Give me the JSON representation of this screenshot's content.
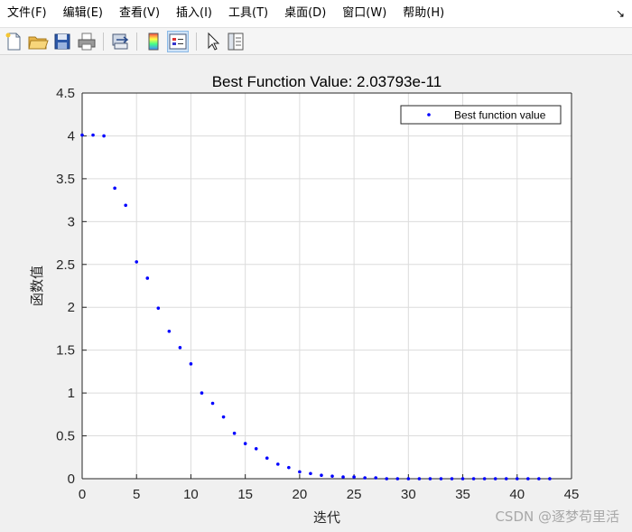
{
  "menu": {
    "items": [
      "文件(F)",
      "编辑(E)",
      "查看(V)",
      "插入(I)",
      "工具(T)",
      "桌面(D)",
      "窗口(W)",
      "帮助(H)"
    ],
    "overflow_glyph": "↘"
  },
  "toolbar": {
    "icons": [
      "new-figure-icon",
      "open-file-icon",
      "save-icon",
      "print-icon",
      "link-plot-icon",
      "colorbar-icon",
      "legend-icon",
      "pointer-icon",
      "property-inspector-icon"
    ]
  },
  "watermark": "CSDN @逐梦苟里活",
  "chart_data": {
    "type": "scatter",
    "title": "Best Function Value: 2.03793e-11",
    "xlabel": "迭代",
    "ylabel": "函数值",
    "xlim": [
      0,
      45
    ],
    "ylim": [
      0,
      4.5
    ],
    "xticks": [
      0,
      5,
      10,
      15,
      20,
      25,
      30,
      35,
      40,
      45
    ],
    "yticks": [
      0,
      0.5,
      1,
      1.5,
      2,
      2.5,
      3,
      3.5,
      4,
      4.5
    ],
    "grid": true,
    "legend_position": "top-right",
    "series": [
      {
        "name": "Best function value",
        "color": "#0000ff",
        "marker": "point",
        "x": [
          0,
          1,
          2,
          3,
          4,
          5,
          6,
          7,
          8,
          9,
          10,
          11,
          12,
          13,
          14,
          15,
          16,
          17,
          18,
          19,
          20,
          21,
          22,
          23,
          24,
          25,
          26,
          27,
          28,
          29,
          30,
          31,
          32,
          33,
          34,
          35,
          36,
          37,
          38,
          39,
          40,
          41,
          42,
          43
        ],
        "y": [
          4.01,
          4.01,
          4.0,
          3.39,
          3.19,
          2.53,
          2.34,
          1.99,
          1.72,
          1.53,
          1.34,
          1.0,
          0.88,
          0.72,
          0.53,
          0.41,
          0.35,
          0.24,
          0.17,
          0.13,
          0.08,
          0.06,
          0.04,
          0.03,
          0.02,
          0.02,
          0.01,
          0.01,
          0.0,
          0.0,
          0.0,
          0.0,
          0.0,
          0.0,
          0.0,
          0.0,
          0.0,
          0.0,
          0.0,
          0.0,
          0.0,
          0.0,
          0.0,
          0.0
        ]
      }
    ]
  }
}
